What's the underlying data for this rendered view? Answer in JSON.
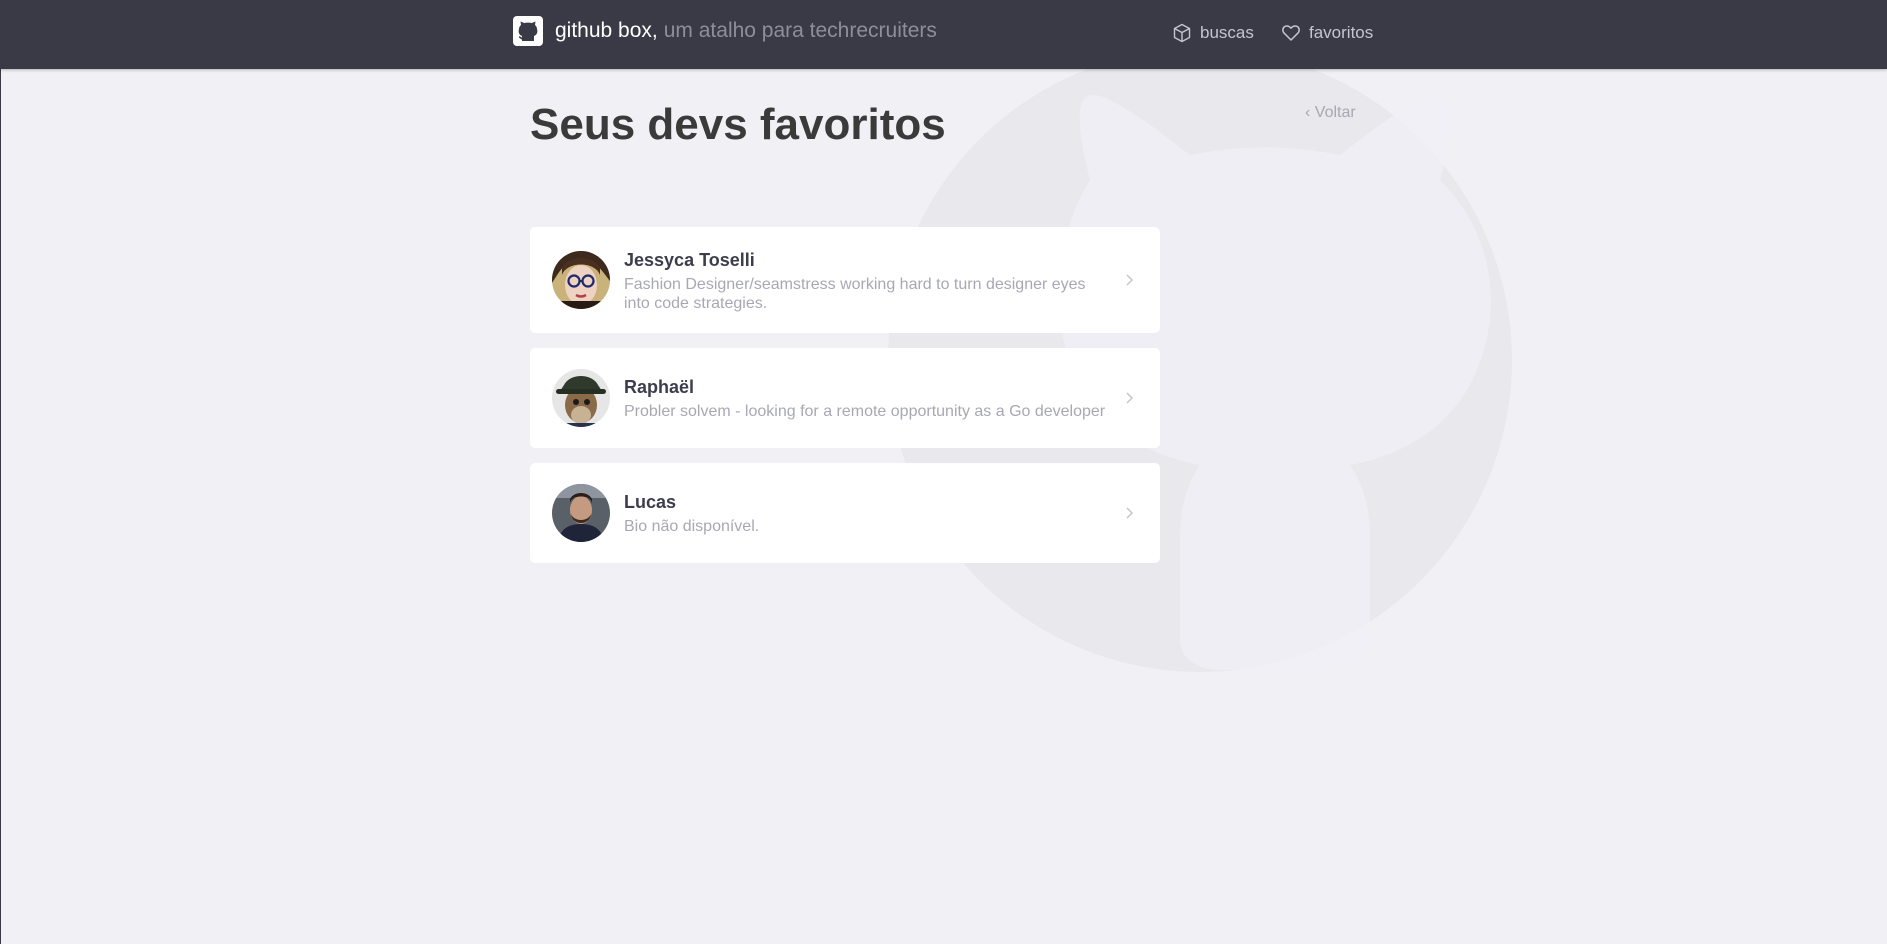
{
  "header": {
    "brand_name": "github box,",
    "tagline": "um atalho para techrecruiters",
    "nav": [
      {
        "label": "buscas",
        "icon": "box-icon"
      },
      {
        "label": "favoritos",
        "icon": "heart-icon"
      }
    ]
  },
  "page": {
    "title": "Seus devs favoritos",
    "back_label": "‹ Voltar"
  },
  "favorites": [
    {
      "name": "Jessyca Toselli",
      "bio": "Fashion Designer/seamstress working hard to turn designer eyes into code strategies."
    },
    {
      "name": "Raphaël",
      "bio": "Probler solvem - looking for a remote opportunity as a Go developer"
    },
    {
      "name": "Lucas",
      "bio": "Bio não disponível."
    }
  ],
  "colors": {
    "header_bg": "#3a3a47",
    "page_bg": "#f0f0f5",
    "card_bg": "#ffffff",
    "title_text": "#3a3a3a",
    "muted_text": "#a8a8b3"
  }
}
